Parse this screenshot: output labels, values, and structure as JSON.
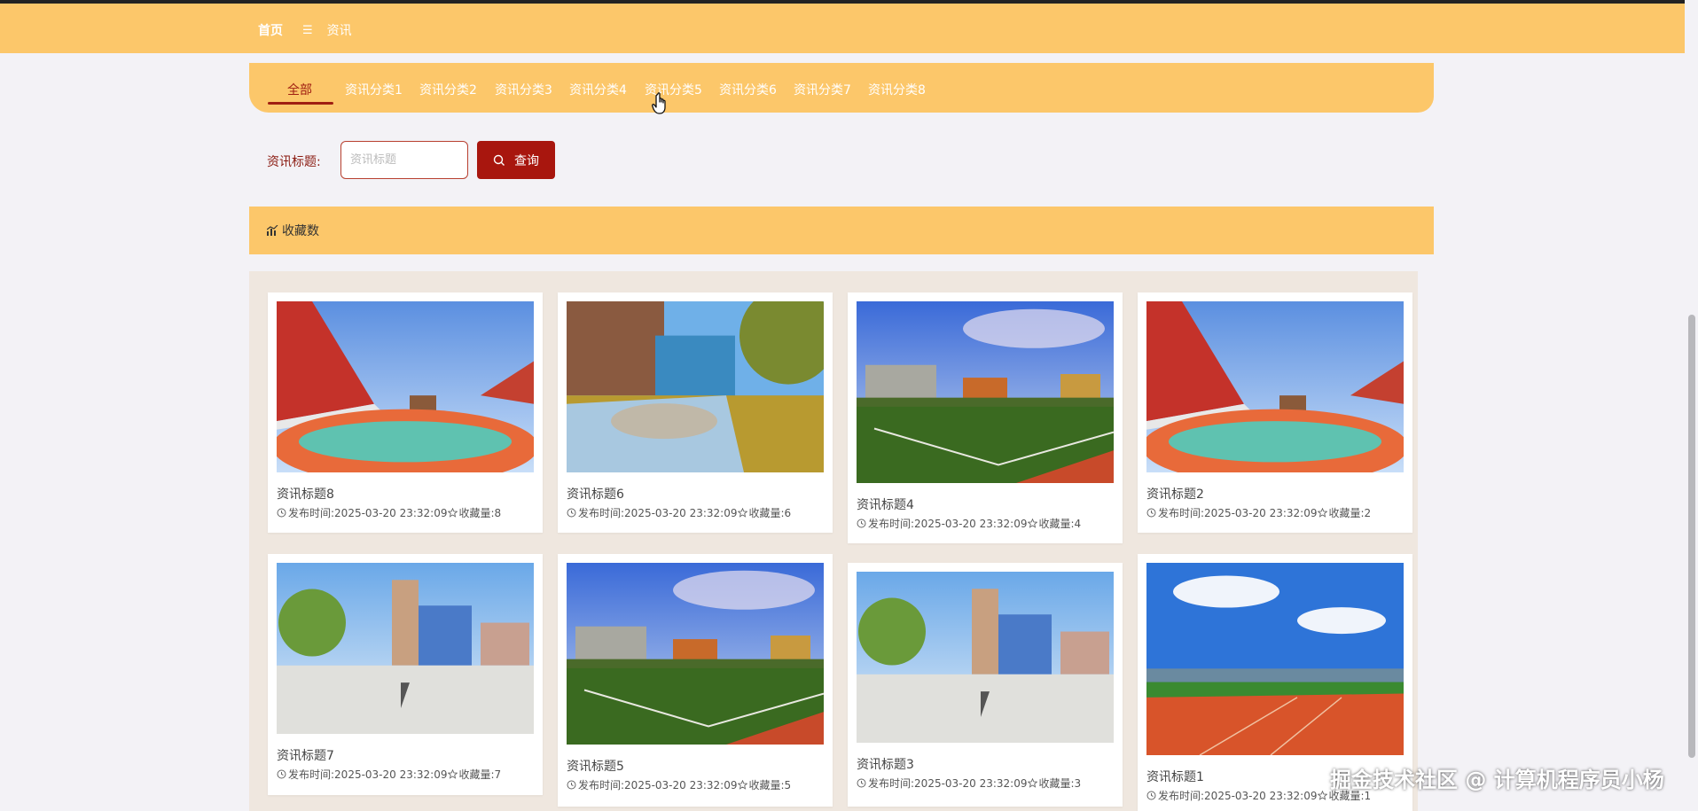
{
  "breadcrumb": {
    "home": "首页",
    "separator": "☰",
    "current": "资讯"
  },
  "categories": [
    {
      "label": "全部",
      "active": true
    },
    {
      "label": "资讯分类1",
      "active": false
    },
    {
      "label": "资讯分类2",
      "active": false
    },
    {
      "label": "资讯分类3",
      "active": false
    },
    {
      "label": "资讯分类4",
      "active": false
    },
    {
      "label": "资讯分类5",
      "active": false
    },
    {
      "label": "资讯分类6",
      "active": false
    },
    {
      "label": "资讯分类7",
      "active": false
    },
    {
      "label": "资讯分类8",
      "active": false
    }
  ],
  "search": {
    "label": "资讯标题:",
    "placeholder": "资讯标题",
    "value": "",
    "button_label": "查询"
  },
  "sort": {
    "label": "收藏数"
  },
  "cards": [
    {
      "title": "资讯标题8",
      "time_label": "发布时间:",
      "time": "2025-03-20 23:32:09",
      "fav_label": "收藏量:",
      "fav": "8",
      "scene": "school-red-track"
    },
    {
      "title": "资讯标题6",
      "time_label": "发布时间:",
      "time": "2025-03-20 23:32:09",
      "fav_label": "收藏量:",
      "fav": "6",
      "scene": "campus-rock"
    },
    {
      "title": "资讯标题4",
      "time_label": "发布时间:",
      "time": "2025-03-20 23:32:09",
      "fav_label": "收藏量:",
      "fav": "4",
      "scene": "field-sunset"
    },
    {
      "title": "资讯标题2",
      "time_label": "发布时间:",
      "time": "2025-03-20 23:32:09",
      "fav_label": "收藏量:",
      "fav": "2",
      "scene": "school-red-track"
    },
    {
      "title": "资讯标题7",
      "time_label": "发布时间:",
      "time": "2025-03-20 23:32:09",
      "fav_label": "收藏量:",
      "fav": "7",
      "scene": "campus-plaza"
    },
    {
      "title": "资讯标题5",
      "time_label": "发布时间:",
      "time": "2025-03-20 23:32:09",
      "fav_label": "收藏量:",
      "fav": "5",
      "scene": "field-sunset"
    },
    {
      "title": "资讯标题3",
      "time_label": "发布时间:",
      "time": "2025-03-20 23:32:09",
      "fav_label": "收藏量:",
      "fav": "3",
      "scene": "campus-plaza"
    },
    {
      "title": "资讯标题1",
      "time_label": "发布时间:",
      "time": "2025-03-20 23:32:09",
      "fav_label": "收藏量:",
      "fav": "1",
      "scene": "stadium-track"
    }
  ],
  "watermark": "掘金技术社区 @ 计算机程序员小杨",
  "colors": {
    "accent": "#fcc76a",
    "brand": "#a8160e",
    "page_bg": "#f3f2f6"
  }
}
